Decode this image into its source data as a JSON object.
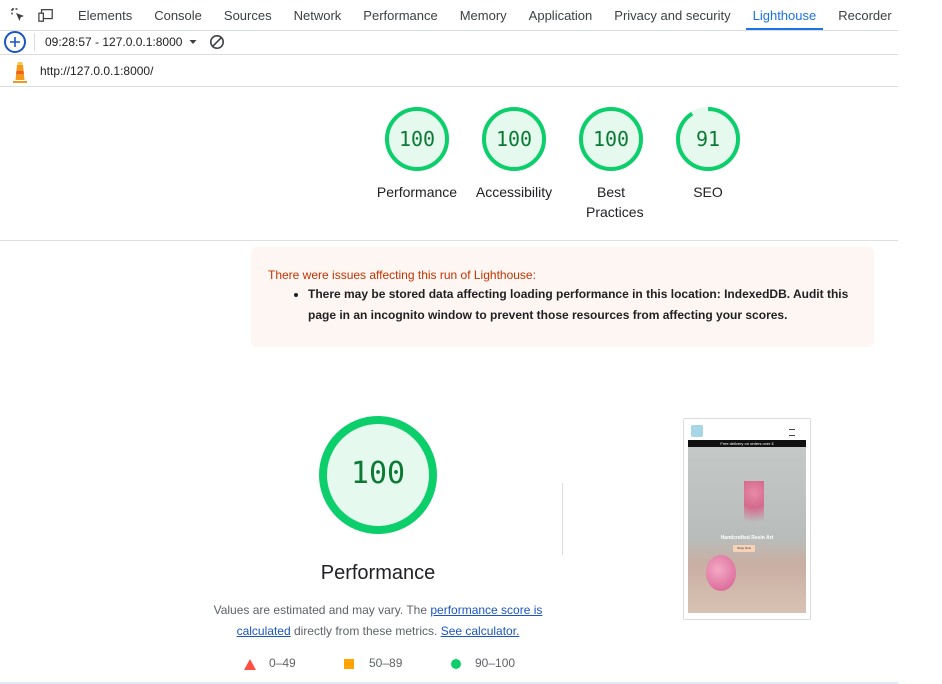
{
  "tabs": [
    "Elements",
    "Console",
    "Sources",
    "Network",
    "Performance",
    "Memory",
    "Application",
    "Privacy and security",
    "Lighthouse",
    "Recorder"
  ],
  "active_tab": "Lighthouse",
  "report_selector": "09:28:57 - 127.0.0.1:8000",
  "url": "http://127.0.0.1:8000/",
  "categories": [
    {
      "score": "100",
      "label": "Performance",
      "value": 100
    },
    {
      "score": "100",
      "label": "Accessibility",
      "value": 100
    },
    {
      "score": "100",
      "label": "Best Practices",
      "value": 100
    },
    {
      "score": "91",
      "label": "SEO",
      "value": 91
    }
  ],
  "warning": {
    "title": "There were issues affecting this run of Lighthouse:",
    "items": [
      "There may be stored data affecting loading performance in this location: IndexedDB. Audit this page in an incognito window to prevent those resources from affecting your scores."
    ]
  },
  "performance": {
    "score": "100",
    "title": "Performance",
    "note_pre": "Values are estimated and may vary. The ",
    "note_link1": "performance score is calculated",
    "note_mid": " directly from these metrics.",
    "note_link2": "See calculator."
  },
  "legend": [
    "0–49",
    "50–89",
    "90–100"
  ],
  "screenshot": {
    "banner": "Free delivery on orders over £",
    "hero_title": "Handcrafted Resin Art",
    "hero_button": "Shop Now"
  },
  "colors": {
    "pass": "#0cce6b",
    "pass_text": "#0c7a35",
    "average": "#ffa400",
    "fail": "#ff4e42",
    "accent": "#1a73e8"
  }
}
